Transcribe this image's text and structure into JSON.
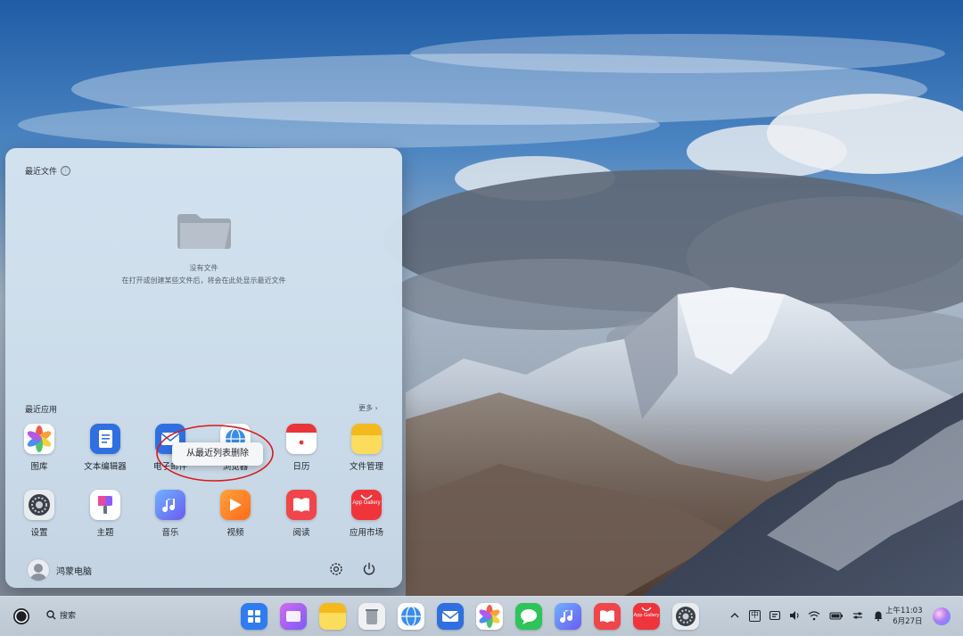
{
  "start_menu": {
    "recent_files_title": "最近文件",
    "info_icon": "ⓘ",
    "empty_title": "没有文件",
    "empty_desc": "在打开或创建某些文件后，将会在此处显示最近文件",
    "recent_apps_title": "最近应用",
    "more_label": "更多 ›",
    "apps": [
      {
        "label": "图库",
        "icon": "gallery-icon"
      },
      {
        "label": "文本编辑器",
        "icon": "text-editor-icon"
      },
      {
        "label": "电子邮件",
        "icon": "mail-icon"
      },
      {
        "label": "浏览器",
        "icon": "browser-icon"
      },
      {
        "label": "日历",
        "icon": "calendar-icon"
      },
      {
        "label": "文件管理",
        "icon": "file-manager-icon"
      },
      {
        "label": "设置",
        "icon": "settings-icon"
      },
      {
        "label": "主题",
        "icon": "theme-icon"
      },
      {
        "label": "音乐",
        "icon": "music-icon"
      },
      {
        "label": "视频",
        "icon": "video-icon"
      },
      {
        "label": "阅读",
        "icon": "reader-icon"
      },
      {
        "label": "应用市场",
        "icon": "app-market-icon",
        "icon_text": "App Gallery"
      }
    ],
    "user_name": "鸿蒙电脑",
    "context_menu_item": "从最近列表删除"
  },
  "taskbar": {
    "search_label": "搜索",
    "apps": [
      "start-grid-icon",
      "multitask-icon",
      "file-manager-icon",
      "trash-icon",
      "browser-icon",
      "mail-icon",
      "gallery-icon",
      "messages-icon",
      "music-icon",
      "reader-icon",
      "app-market-icon",
      "settings-icon"
    ],
    "app_market_text": "App Gallery",
    "tray": {
      "chevron": "^",
      "ime": "中",
      "ime2": "英"
    },
    "time": "上午11:03",
    "date": "6月27日"
  },
  "colors": {
    "accent": "#2f6fe0",
    "annotation": "#d61b1b"
  }
}
